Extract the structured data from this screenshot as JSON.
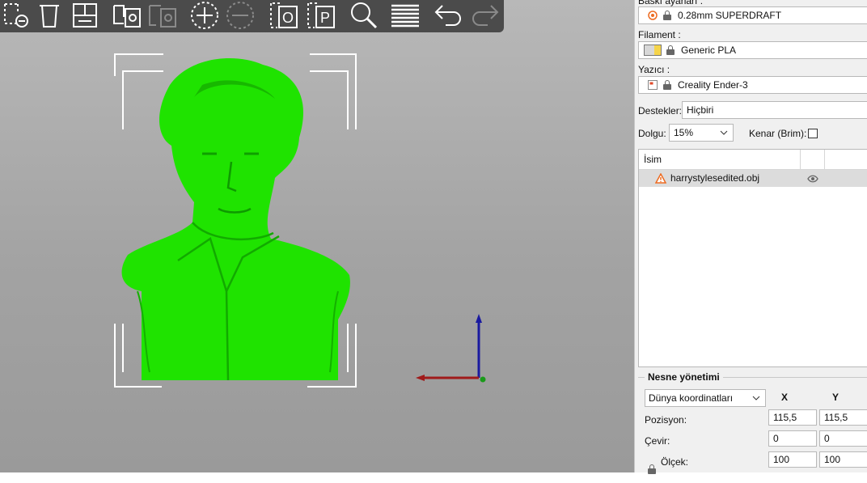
{
  "toolbar": {
    "buttons": [
      {
        "name": "add-object-icon",
        "enabled": true
      },
      {
        "name": "delete-icon",
        "enabled": true
      },
      {
        "name": "arrange-icon",
        "enabled": true
      },
      {
        "name": "copy-icon",
        "enabled": true
      },
      {
        "name": "paste-icon",
        "enabled": false
      },
      {
        "name": "add-instance-icon",
        "enabled": true
      },
      {
        "name": "remove-instance-icon",
        "enabled": false
      },
      {
        "name": "split-objects-icon",
        "enabled": true
      },
      {
        "name": "split-parts-icon",
        "enabled": true
      },
      {
        "name": "search-icon",
        "enabled": true
      },
      {
        "name": "layers-icon",
        "enabled": true
      },
      {
        "name": "undo-icon",
        "enabled": true
      },
      {
        "name": "redo-icon",
        "enabled": false
      }
    ],
    "split_objects_letter": "O",
    "split_parts_letter": "P"
  },
  "panel": {
    "print_settings_label": "Baskı ayarları :",
    "print_settings_value": "0.28mm SUPERDRAFT",
    "filament_label": "Filament :",
    "filament_value": "Generic PLA",
    "filament_color": "#f5d44a",
    "printer_label": "Yazıcı :",
    "printer_value": "Creality Ender-3",
    "supports_label": "Destekler:",
    "supports_value": "Hiçbiri",
    "infill_label": "Dolgu:",
    "infill_value": "15%",
    "brim_label": "Kenar (Brim):",
    "brim_checked": false,
    "list_header_name": "İsim",
    "objects": [
      {
        "name": "harrystylesedited.obj",
        "warning": true
      }
    ]
  },
  "manipulation": {
    "title": "Nesne yönetimi",
    "coord_system": "Dünya koordinatları",
    "axis_x": "X",
    "axis_y": "Y",
    "position_label": "Pozisyon:",
    "rotation_label": "Çevir:",
    "scale_label": "Ölçek:",
    "position": {
      "x": "115,5",
      "y": "115,5"
    },
    "rotation": {
      "x": "0",
      "y": "0"
    },
    "scale": {
      "x": "100",
      "y": "100"
    }
  },
  "colors": {
    "model": "#1fe300",
    "accent": "#ed6b21"
  }
}
